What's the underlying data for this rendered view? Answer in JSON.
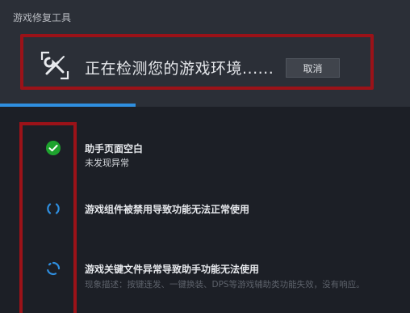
{
  "window": {
    "title": "游戏修复工具"
  },
  "status": {
    "message": "正在检测您的游戏环境......",
    "cancel_label": "取消",
    "progress_fraction": 0.33
  },
  "icons": {
    "tool": "wrench-screwdriver-icon",
    "done": "check-circle-icon",
    "loading": "spinner-icon"
  },
  "colors": {
    "accent": "#2f8fe0",
    "success": "#1ea32e",
    "highlight": "#9b1218"
  },
  "items": [
    {
      "title": "助手页面空白",
      "desc": "未发现异常",
      "state": "done"
    },
    {
      "title": "游戏组件被禁用导致功能无法正常使用",
      "desc": "",
      "state": "checking"
    },
    {
      "title": "游戏关键文件异常导致助手功能无法使用",
      "desc": "现象描述：按键连发、一键换装、DPS等游戏辅助类功能失效，没有响应。",
      "state": "checking"
    }
  ]
}
